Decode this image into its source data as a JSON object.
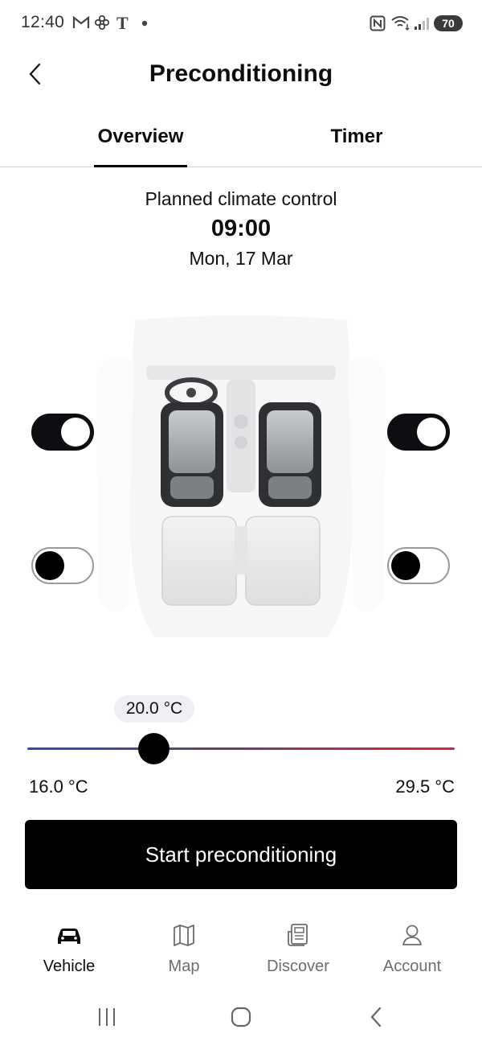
{
  "status_bar": {
    "time": "12:40",
    "battery": "70",
    "notification_icons": [
      "gmail-icon",
      "pinwheel-icon",
      "t-app-icon",
      "dot-icon"
    ],
    "system_icons": [
      "nfc-icon",
      "wifi-icon",
      "signal-icon",
      "battery-icon"
    ],
    "t_glyph": "T"
  },
  "header": {
    "title": "Preconditioning",
    "back_icon": "chevron-left-icon"
  },
  "tabs": [
    {
      "label": "Overview",
      "active": true
    },
    {
      "label": "Timer",
      "active": false
    }
  ],
  "planned": {
    "label": "Planned climate control",
    "time": "09:00",
    "date": "Mon, 17 Mar"
  },
  "seat_heating": {
    "front_left": true,
    "front_right": true,
    "rear_left": false,
    "rear_right": false
  },
  "temperature": {
    "current": "20.0 °C",
    "min": "16.0 °C",
    "max": "29.5 °C",
    "value": 20.0,
    "range": [
      16.0,
      29.5
    ]
  },
  "cta": {
    "label": "Start preconditioning"
  },
  "bottom_nav": [
    {
      "label": "Vehicle",
      "icon": "car-icon",
      "active": true
    },
    {
      "label": "Map",
      "icon": "map-icon",
      "active": false
    },
    {
      "label": "Discover",
      "icon": "news-icon",
      "active": false
    },
    {
      "label": "Account",
      "icon": "user-icon",
      "active": false
    }
  ],
  "system_nav": [
    "recents-icon",
    "home-icon",
    "back-icon"
  ],
  "colors": {
    "accent": "#0e0e12",
    "slider_cold": "#2f4ea5",
    "slider_hot": "#d5283a",
    "inactive_nav": "#6b6d70"
  }
}
